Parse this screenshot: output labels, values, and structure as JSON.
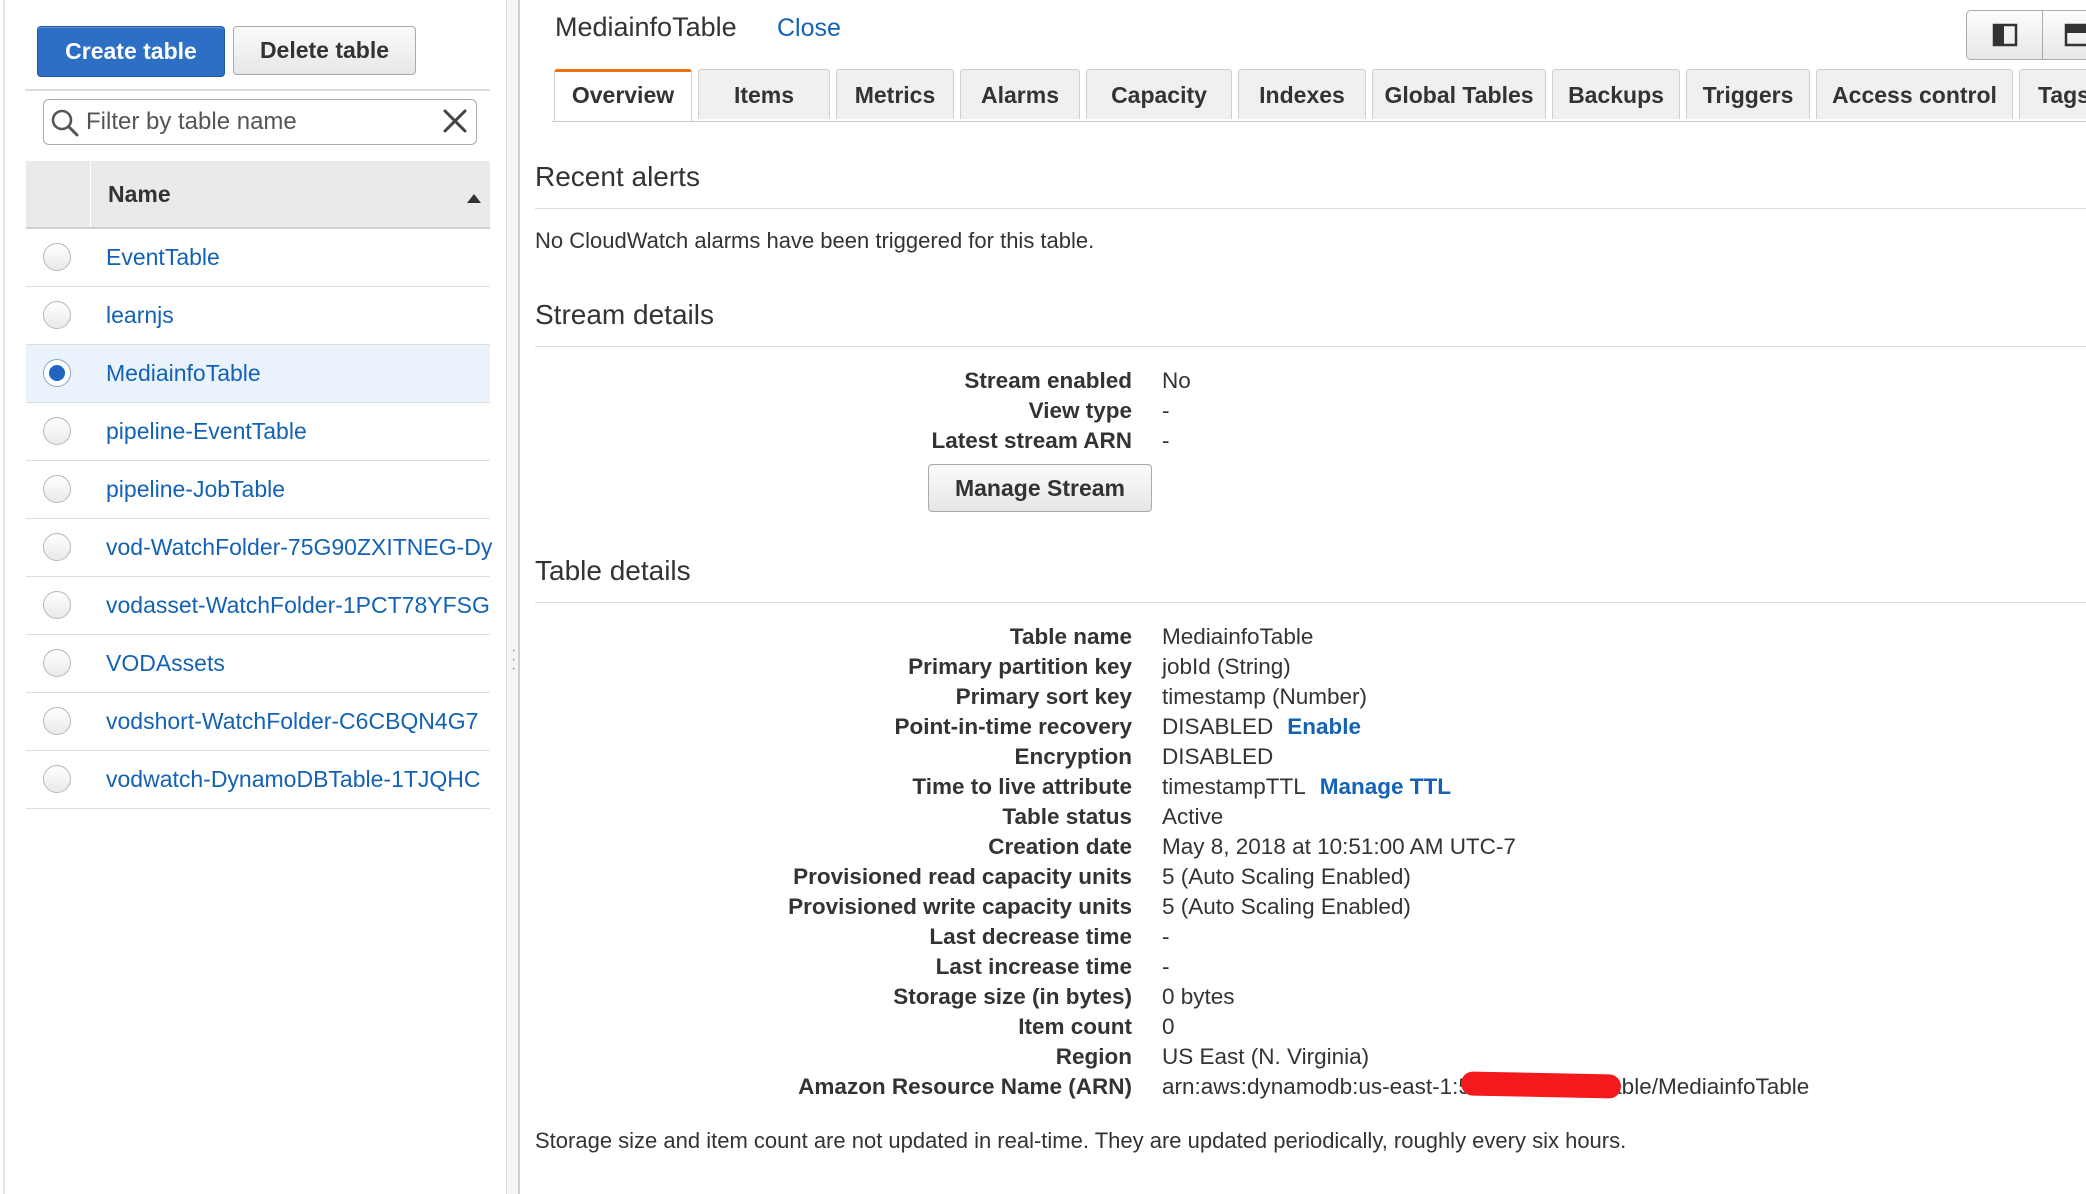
{
  "toolbar": {
    "create_label": "Create table",
    "delete_label": "Delete table"
  },
  "filter": {
    "placeholder": "Filter by table name",
    "value": ""
  },
  "table_list": {
    "header": "Name",
    "rows": [
      {
        "name": "EventTable",
        "selected": false
      },
      {
        "name": "learnjs",
        "selected": false
      },
      {
        "name": "MediainfoTable",
        "selected": true
      },
      {
        "name": "pipeline-EventTable",
        "selected": false
      },
      {
        "name": "pipeline-JobTable",
        "selected": false
      },
      {
        "name": "vod-WatchFolder-75G90ZXITNEG-Dу",
        "selected": false
      },
      {
        "name": "vodasset-WatchFolder-1PCT78YFSG",
        "selected": false
      },
      {
        "name": "VODAssets",
        "selected": false
      },
      {
        "name": "vodshort-WatchFolder-C6CBQN4G7",
        "selected": false
      },
      {
        "name": "vodwatch-DynamoDBTable-1TJQHC",
        "selected": false
      }
    ]
  },
  "detail": {
    "title": "MediainfoTable",
    "close_label": "Close",
    "tabs": [
      "Overview",
      "Items",
      "Metrics",
      "Alarms",
      "Capacity",
      "Indexes",
      "Global Tables",
      "Backups",
      "Triggers",
      "Access control",
      "Tags"
    ],
    "active_tab": "Overview",
    "recent_alerts": {
      "title": "Recent alerts",
      "message": "No CloudWatch alarms have been triggered for this table."
    },
    "stream": {
      "title": "Stream details",
      "rows": [
        {
          "label": "Stream enabled",
          "value": "No"
        },
        {
          "label": "View type",
          "value": "-"
        },
        {
          "label": "Latest stream ARN",
          "value": "-"
        }
      ],
      "manage_label": "Manage Stream"
    },
    "table_details": {
      "title": "Table details",
      "rows": [
        {
          "label": "Table name",
          "value": "MediainfoTable"
        },
        {
          "label": "Primary partition key",
          "value": "jobId (String)"
        },
        {
          "label": "Primary sort key",
          "value": "timestamp (Number)"
        },
        {
          "label": "Point-in-time recovery",
          "value": "DISABLED",
          "link": "Enable"
        },
        {
          "label": "Encryption",
          "value": "DISABLED"
        },
        {
          "label": "Time to live attribute",
          "value": "timestampTTL",
          "link": "Manage TTL"
        },
        {
          "label": "Table status",
          "value": "Active"
        },
        {
          "label": "Creation date",
          "value": "May 8, 2018 at 10:51:00 AM UTC-7"
        },
        {
          "label": "Provisioned read capacity units",
          "value": "5 (Auto Scaling Enabled)"
        },
        {
          "label": "Provisioned write capacity units",
          "value": "5 (Auto Scaling Enabled)"
        },
        {
          "label": "Last decrease time",
          "value": "-"
        },
        {
          "label": "Last increase time",
          "value": "-"
        },
        {
          "label": "Storage size (in bytes)",
          "value": "0 bytes"
        },
        {
          "label": "Item count",
          "value": "0"
        },
        {
          "label": "Region",
          "value": "US East (N. Virginia)"
        },
        {
          "label": "Amazon Resource Name (ARN)",
          "value_prefix": "arn:aws:dynamodb:us-east-1:5",
          "value_suffix": "table/MediainfoTable"
        }
      ],
      "footnote": "Storage size and item count are not updated in real-time. They are updated periodically, roughly every six hours."
    }
  },
  "icons": {
    "filter": "search-icon",
    "clear": "close-icon",
    "sort": "sort-ascending-icon",
    "view_split": "split-view-icon",
    "view_full": "full-view-icon",
    "splitter": "drag-handle-icon"
  },
  "colors": {
    "primary": "#2d6fc4",
    "link": "#1362b5",
    "active_tab": "#ec7211",
    "selected_row": "#eaf3fb",
    "redaction": "#f4191c"
  }
}
